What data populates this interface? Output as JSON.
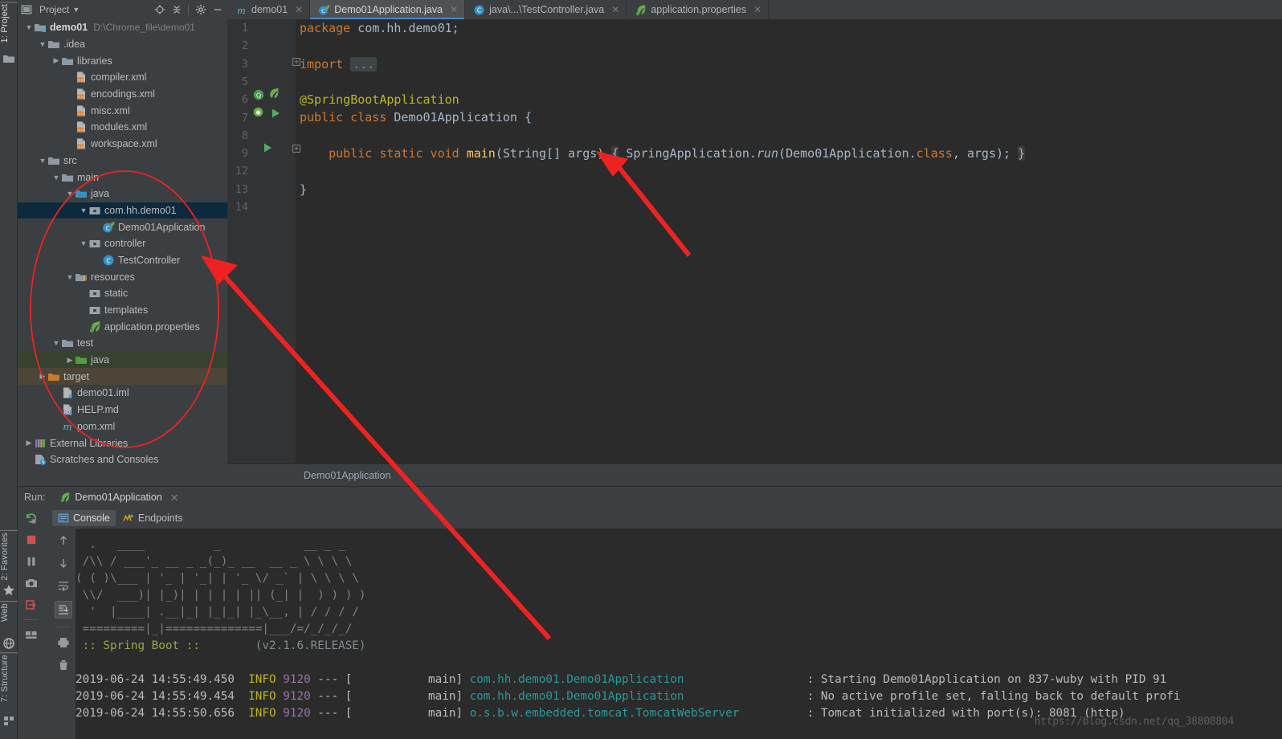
{
  "left_strip": {
    "top_tab": "1: Project",
    "bottom_tabs": [
      "2: Favorites",
      "Web",
      "7: Structure"
    ]
  },
  "project_panel": {
    "title": "Project",
    "icons": [
      "target-locate-icon",
      "collapse-all-icon",
      "gear-icon",
      "hide-icon"
    ],
    "tree": [
      {
        "depth": 0,
        "arrow": "down",
        "icon": "module-icon",
        "label": "demo01",
        "path": "D:\\Chrome_file\\demo01",
        "bold": true,
        "state": "normal"
      },
      {
        "depth": 1,
        "arrow": "down",
        "icon": "folder-icon",
        "label": ".idea",
        "path": "",
        "bold": false,
        "state": "normal"
      },
      {
        "depth": 2,
        "arrow": "right",
        "icon": "folder-icon",
        "label": "libraries",
        "path": "",
        "bold": false,
        "state": "normal"
      },
      {
        "depth": 3,
        "arrow": "none",
        "icon": "xml-file-icon",
        "label": "compiler.xml",
        "path": "",
        "bold": false,
        "state": "normal"
      },
      {
        "depth": 3,
        "arrow": "none",
        "icon": "xml-file-icon",
        "label": "encodings.xml",
        "path": "",
        "bold": false,
        "state": "normal"
      },
      {
        "depth": 3,
        "arrow": "none",
        "icon": "xml-file-icon",
        "label": "misc.xml",
        "path": "",
        "bold": false,
        "state": "normal"
      },
      {
        "depth": 3,
        "arrow": "none",
        "icon": "xml-file-icon",
        "label": "modules.xml",
        "path": "",
        "bold": false,
        "state": "normal"
      },
      {
        "depth": 3,
        "arrow": "none",
        "icon": "xml-file-icon",
        "label": "workspace.xml",
        "path": "",
        "bold": false,
        "state": "normal"
      },
      {
        "depth": 1,
        "arrow": "down",
        "icon": "folder-icon",
        "label": "src",
        "path": "",
        "bold": false,
        "state": "normal"
      },
      {
        "depth": 2,
        "arrow": "down",
        "icon": "folder-icon",
        "label": "main",
        "path": "",
        "bold": false,
        "state": "normal"
      },
      {
        "depth": 3,
        "arrow": "down",
        "icon": "source-root-icon",
        "label": "java",
        "path": "",
        "bold": false,
        "state": "normal"
      },
      {
        "depth": 4,
        "arrow": "down",
        "icon": "package-icon",
        "label": "com.hh.demo01",
        "path": "",
        "bold": false,
        "state": "selected"
      },
      {
        "depth": 5,
        "arrow": "none",
        "icon": "spring-class-icon",
        "label": "Demo01Application",
        "path": "",
        "bold": false,
        "state": "normal"
      },
      {
        "depth": 4,
        "arrow": "down",
        "icon": "package-icon",
        "label": "controller",
        "path": "",
        "bold": false,
        "state": "normal"
      },
      {
        "depth": 5,
        "arrow": "none",
        "icon": "java-class-icon",
        "label": "TestController",
        "path": "",
        "bold": false,
        "state": "normal"
      },
      {
        "depth": 3,
        "arrow": "down",
        "icon": "resource-root-icon",
        "label": "resources",
        "path": "",
        "bold": false,
        "state": "normal"
      },
      {
        "depth": 4,
        "arrow": "none",
        "icon": "package-icon",
        "label": "static",
        "path": "",
        "bold": false,
        "state": "normal"
      },
      {
        "depth": 4,
        "arrow": "none",
        "icon": "package-icon",
        "label": "templates",
        "path": "",
        "bold": false,
        "state": "normal"
      },
      {
        "depth": 4,
        "arrow": "none",
        "icon": "spring-leaf-icon",
        "label": "application.properties",
        "path": "",
        "bold": false,
        "state": "normal"
      },
      {
        "depth": 2,
        "arrow": "down",
        "icon": "folder-icon",
        "label": "test",
        "path": "",
        "bold": false,
        "state": "normal"
      },
      {
        "depth": 3,
        "arrow": "right",
        "icon": "test-root-icon",
        "label": "java",
        "path": "",
        "bold": false,
        "state": "green"
      },
      {
        "depth": 1,
        "arrow": "right",
        "icon": "target-folder-icon",
        "label": "target",
        "path": "",
        "bold": false,
        "state": "target"
      },
      {
        "depth": 2,
        "arrow": "none",
        "icon": "iml-file-icon",
        "label": "demo01.iml",
        "path": "",
        "bold": false,
        "state": "normal"
      },
      {
        "depth": 2,
        "arrow": "none",
        "icon": "md-file-icon",
        "label": "HELP.md",
        "path": "",
        "bold": false,
        "state": "normal"
      },
      {
        "depth": 2,
        "arrow": "none",
        "icon": "maven-file-icon",
        "label": "pom.xml",
        "path": "",
        "bold": false,
        "state": "normal"
      },
      {
        "depth": 0,
        "arrow": "right",
        "icon": "libraries-icon",
        "label": "External Libraries",
        "path": "",
        "bold": false,
        "state": "normal"
      },
      {
        "depth": 0,
        "arrow": "none",
        "icon": "scratches-icon",
        "label": "Scratches and Consoles",
        "path": "",
        "bold": false,
        "state": "normal"
      }
    ]
  },
  "editor": {
    "tabs": [
      {
        "label": "demo01",
        "icon": "maven-m-icon",
        "active": false,
        "closable": true
      },
      {
        "label": "Demo01Application.java",
        "icon": "spring-class-icon",
        "active": true,
        "closable": true
      },
      {
        "label": "java\\...\\TestController.java",
        "icon": "java-class-icon",
        "active": false,
        "closable": true
      },
      {
        "label": "application.properties",
        "icon": "spring-leaf-icon",
        "active": false,
        "closable": true
      }
    ],
    "line_numbers": [
      "1",
      "2",
      "3",
      "5",
      "6",
      "7",
      "8",
      "9",
      "12",
      "13",
      "14"
    ],
    "breadcrumb": "Demo01Application",
    "code": {
      "l1_kw": "package",
      "l1_rest": " com.hh.demo01;",
      "l3_kw": "import",
      "l3_dots": "...",
      "l6_annotation": "@SpringBootApplication",
      "l7_kw1": "public",
      "l7_kw2": "class",
      "l7_name": "Demo01Application",
      "l7_brace": "{",
      "l9_kw1": "public",
      "l9_kw2": "static",
      "l9_kw3": "void",
      "l9_method": "main",
      "l9_params": "(String[] args)",
      "l9_open": "{",
      "l9_body1": "SpringApplication.",
      "l9_run": "run",
      "l9_body2": "(Demo01Application.",
      "l9_class": "class",
      "l9_body3": ", args);",
      "l9_close": "}",
      "l13_brace": "}"
    }
  },
  "run_panel": {
    "run_label": "Run:",
    "run_config": "Demo01Application",
    "tabs": [
      {
        "label": "Console",
        "icon": "console-icon",
        "active": true
      },
      {
        "label": "Endpoints",
        "icon": "endpoints-icon",
        "active": false
      }
    ],
    "toolbar_left": [
      "rerun-icon",
      "stop-icon",
      "pause-icon",
      "camera-icon",
      "thread-dump-icon",
      "layout-icon"
    ],
    "toolbar_second": [
      "scroll-up-icon",
      "scroll-down-icon",
      "soft-wrap-icon",
      "scroll-to-end-icon",
      "print-icon",
      "trash-icon"
    ],
    "console": {
      "banner": [
        "  .   ____          _            __ _ _",
        " /\\\\ / ___'_ __ _ _(_)_ __  __ _ \\ \\ \\ \\",
        "( ( )\\___ | '_ | '_| | '_ \\/ _` | \\ \\ \\ \\",
        " \\\\/  ___)| |_)| | | | | || (_| |  ) ) ) )",
        "  '  |____| .__|_| |_|_| |_\\__, | / / / /",
        " =========|_|==============|___/=/_/_/_/"
      ],
      "spring_boot_label": " :: Spring Boot :: ",
      "version": "       (v2.1.6.RELEASE)",
      "logs": [
        {
          "date": "2019-06-24 14:55:49.450",
          "level": "INFO",
          "pid": "9120",
          "sep": "--- [",
          "thread": "           main]",
          "logger": "com.hh.demo01.Demo01Application",
          "message": ": Starting Demo01Application on 837-wuby with PID 91"
        },
        {
          "date": "2019-06-24 14:55:49.454",
          "level": "INFO",
          "pid": "9120",
          "sep": "--- [",
          "thread": "           main]",
          "logger": "com.hh.demo01.Demo01Application",
          "message": ": No active profile set, falling back to default profi"
        },
        {
          "date": "2019-06-24 14:55:50.656",
          "level": "INFO",
          "pid": "9120",
          "sep": "--- [",
          "thread": "           main]",
          "logger": "o.s.b.w.embedded.tomcat.TomcatWebServer",
          "message": ": Tomcat initialized with port(s): 8081 (http)"
        }
      ]
    }
  },
  "annotations": {
    "ellipse": "red-ellipse-highlight",
    "arrows": [
      "red-arrow-to-main-args",
      "red-arrow-to-testcontroller"
    ],
    "watermark": "https://blog.csdn.net/qq_38808804"
  },
  "colors": {
    "accent": "#4a88c7",
    "selection": "#0d293e",
    "annotation_red": "#ee2222",
    "editor_bg": "#2b2b2b",
    "panel_bg": "#3c3f41"
  }
}
